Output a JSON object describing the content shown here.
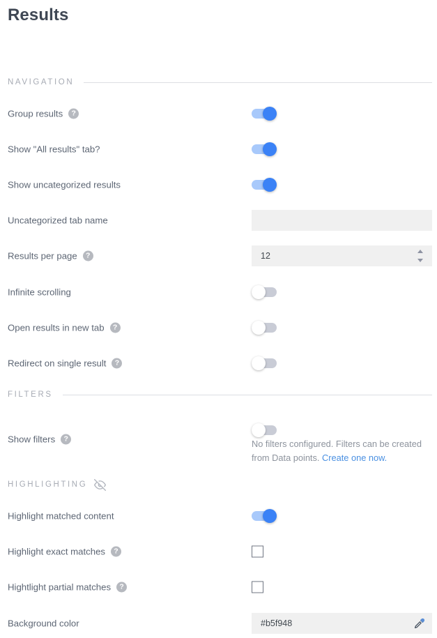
{
  "page": {
    "title": "Results"
  },
  "sections": {
    "navigation": {
      "title": "NAVIGATION"
    },
    "filters": {
      "title": "FILTERS"
    },
    "highlighting": {
      "title": "HIGHLIGHTING",
      "icon": "eye-off-icon"
    }
  },
  "rows": {
    "group_results": {
      "label": "Group results",
      "help": "?",
      "toggle_state": "on"
    },
    "show_all_results_tab": {
      "label": "Show \"All results\" tab?",
      "toggle_state": "on"
    },
    "show_uncategorized_results": {
      "label": "Show uncategorized results",
      "toggle_state": "on"
    },
    "uncategorized_tab_name": {
      "label": "Uncategorized tab name",
      "value": "",
      "placeholder": ""
    },
    "results_per_page": {
      "label": "Results per page",
      "help": "?",
      "value": "12"
    },
    "infinite_scrolling": {
      "label": "Infinite scrolling",
      "toggle_state": "off"
    },
    "open_results_in_new_tab": {
      "label": "Open results in new tab",
      "help": "?",
      "toggle_state": "off"
    },
    "redirect_on_single_result": {
      "label": "Redirect on single result",
      "help": "?",
      "toggle_state": "off"
    },
    "show_filters": {
      "label": "Show filters",
      "help": "?",
      "toggle_state": "off",
      "helper_text_before": "No filters configured. Filters can be created from Data points. ",
      "helper_link": "Create one now."
    },
    "highlight_matched_content": {
      "label": "Highlight matched content",
      "toggle_state": "on"
    },
    "highlight_exact_matches": {
      "label": "Highlight exact matches",
      "help": "?",
      "checked": false
    },
    "highlight_partial_matches": {
      "label": "Hightlight partial matches",
      "help": "?",
      "checked": false
    },
    "background_color": {
      "label": "Background color",
      "value": "#b5f948",
      "icon": "eyedropper-icon"
    }
  },
  "colors": {
    "toggle_on_track": "#a8c9fb",
    "toggle_on_knob": "#3b82f6",
    "toggle_off_track": "#c9ccd6",
    "link": "#4a90e2",
    "label_text": "#5d6674",
    "section_text": "#a7abb4",
    "input_bg": "#f0f0f0"
  }
}
